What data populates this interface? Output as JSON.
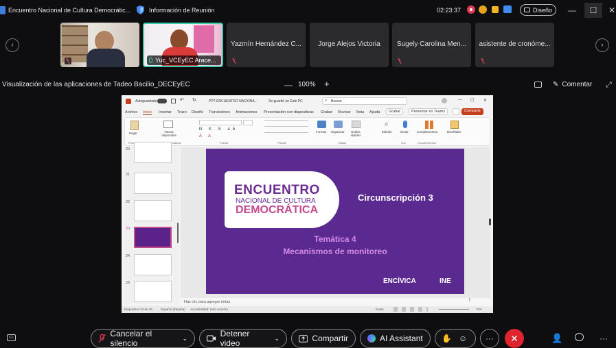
{
  "window": {
    "title": "Encuentro Nacional de Cultura Democrátic...",
    "meeting_info": "Información de Reunión",
    "time": "02:23:37",
    "design_label": "Diseño",
    "colors": {
      "background": "#0e0e10",
      "leave": "#e0242f"
    }
  },
  "participants": [
    {
      "name": "",
      "video": true,
      "muted": true
    },
    {
      "name": "Yuc_VCEyEC Arace...",
      "video": true,
      "muted": false,
      "active": true
    },
    {
      "name": "Yazmín Hernández C...",
      "video": false,
      "muted": true
    },
    {
      "name": "Jorge Alejos Victoria",
      "video": false,
      "muted": false
    },
    {
      "name": "Sugely Carolina Men...",
      "video": false,
      "muted": true
    },
    {
      "name": "asistente de cronóme...",
      "video": false,
      "muted": true
    }
  ],
  "share": {
    "title": "Visualización de las aplicaciones de Tadeo Bacilio_DECEyEC",
    "zoom": "100%",
    "comment_label": "Comentar"
  },
  "ppt": {
    "autosave": "Autoguardado",
    "filename": "PPT ENCUENTRO NACIONA...",
    "saved": "Se guardó en Este PC",
    "search": "Buscar",
    "menu": [
      "Archivo",
      "Inicio",
      "Insertar",
      "Trazo",
      "Diseño",
      "Transiciones",
      "Animaciones",
      "Presentación con diapositivas",
      "Grabar",
      "Revisar",
      "Vista",
      "Ayuda"
    ],
    "record": "Grabar",
    "present_teams": "Presentar en Teams",
    "share": "Compartir",
    "ribbon_groups": [
      "Portapapeles",
      "Diapositivas",
      "Fuente",
      "Párrafo",
      "Dibujo",
      "Voz",
      "Complementos"
    ],
    "ribbon_items": [
      "Pegar",
      "Nueva diapositiva",
      "Formas",
      "Organizar",
      "Estilos rápidos",
      "Edición",
      "Dictar",
      "Complementos",
      "Diseñador"
    ],
    "slide_numbers": [
      "20",
      "21",
      "22",
      "23",
      "24",
      "25"
    ],
    "selected_slide": "23",
    "notes_placeholder": "Haz clic para agregar notas",
    "status_slide": "Diapositiva 23 de 48",
    "status_lang": "Español (España)",
    "status_access": "Accesibilidad: todo correcto",
    "status_notes": "Notas",
    "status_zoom": "78%"
  },
  "slide": {
    "logo_line1": "ENCUENTRO",
    "logo_line2": "NACIONAL DE CULTURA",
    "logo_line3": "DEMOCRÁTICA",
    "circ": "Circunscripción 3",
    "theme_line1": "Temática 4",
    "theme_line2": "Mecanismos de monitoreo",
    "brand1": "ENCÍVICA",
    "brand2": "INE",
    "colors": {
      "bg": "#5b2a91",
      "accent": "#d48ae6",
      "logo_purple": "#6b2b93"
    }
  },
  "controls": {
    "unmute": "Cancelar el silencio",
    "stop_video": "Detener video",
    "share": "Compartir",
    "ai": "AI Assistant"
  }
}
